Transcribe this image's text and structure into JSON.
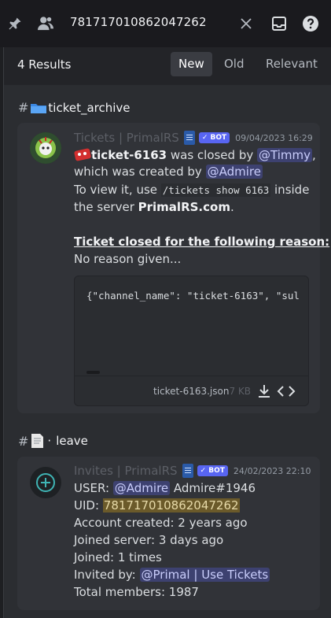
{
  "search": {
    "query": "781717010862047262"
  },
  "topbar": {
    "icons": [
      "pin-icon",
      "members-icon",
      "clear-icon",
      "inbox-icon",
      "help-icon"
    ]
  },
  "results": {
    "count_label": "4 Results",
    "sort_tabs": [
      {
        "label": "New",
        "active": true
      },
      {
        "label": "Old",
        "active": false
      },
      {
        "label": "Relevant",
        "active": false
      }
    ]
  },
  "groups": [
    {
      "channel": "ticket_archive",
      "channel_icon": "folder-icon",
      "message": {
        "author": "Tickets | PrimalRS",
        "bot_tag": "BOT",
        "timestamp": "09/04/2023 16:29",
        "ticket_name": "ticket-6163",
        "closed_by_text": " was closed by ",
        "closed_by": "@Timmy",
        "comma": ",",
        "created_by_text": "which was created by ",
        "created_by": "@Admire",
        "view_text_1": "To view it, use ",
        "view_command": "/tickets show 6163",
        "view_text_2": " inside",
        "server_text": "the server ",
        "server_name": "PrimalRS.com",
        "period": ".",
        "reason_heading": "Ticket closed for the following reason:",
        "reason": "No reason given...",
        "attachment": {
          "preview": "{\"channel_name\": \"ticket-6163\", \"sul",
          "file_name": "ticket-6163.json",
          "file_size": "7 KB"
        }
      }
    },
    {
      "channel": "leave",
      "channel_prefix": "·",
      "channel_icon": "page-icon",
      "message": {
        "author": "Invites | PrimalRS",
        "bot_tag": "BOT",
        "timestamp": "24/02/2023 22:10",
        "user_label": "USER: ",
        "user_mention": "@Admire",
        "user_tag": " Admire#1946",
        "uid_label": "UID: ",
        "uid_value": "781717010862047262",
        "account_created": "Account created: 2 years ago",
        "joined_server": "Joined server: 3 days ago",
        "joined": "Joined: 1 times",
        "invited_label": "Invited by: ",
        "invited_mention": "@Primal | Use Tickets",
        "total_members": "Total members: 1987"
      }
    }
  ],
  "colors": {
    "accent": "#5865f2",
    "panel": "#2b2d31",
    "card": "#313338",
    "highlight": "#6b5a2a",
    "invite_icon": "#3fb4b4"
  }
}
